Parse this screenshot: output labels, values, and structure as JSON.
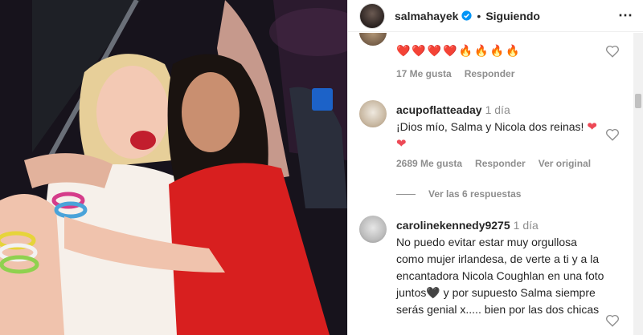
{
  "post": {
    "username": "salmahayek",
    "follow_status": "Siguiendo",
    "separator": "•",
    "more_icon": "⋯"
  },
  "comments": [
    {
      "emoji_row": "❤️❤️❤️❤️🔥🔥🔥🔥",
      "likes": "17 Me gusta",
      "reply": "Responder"
    },
    {
      "user": "acupoflatteaday",
      "time": "1 día",
      "text": "¡Dios mío, Salma y Nicola dos reinas!",
      "hearts": "❤ ❤",
      "likes": "2689 Me gusta",
      "reply": "Responder",
      "translate": "Ver original",
      "view_replies": "Ver las 6 respuestas"
    },
    {
      "user": "carolinekennedy9275",
      "time": "1 día",
      "text": "No puedo evitar estar muy orgullosa como mujer irlandesa, de verte a ti y a la encantadora Nicola Coughlan en una foto juntos🖤 y por supuesto Salma siempre serás genial x..... bien por las dos chicas"
    }
  ],
  "colors": {
    "heart": "#ed4956",
    "verified": "#0095f6",
    "muted": "#8e8e8e"
  }
}
